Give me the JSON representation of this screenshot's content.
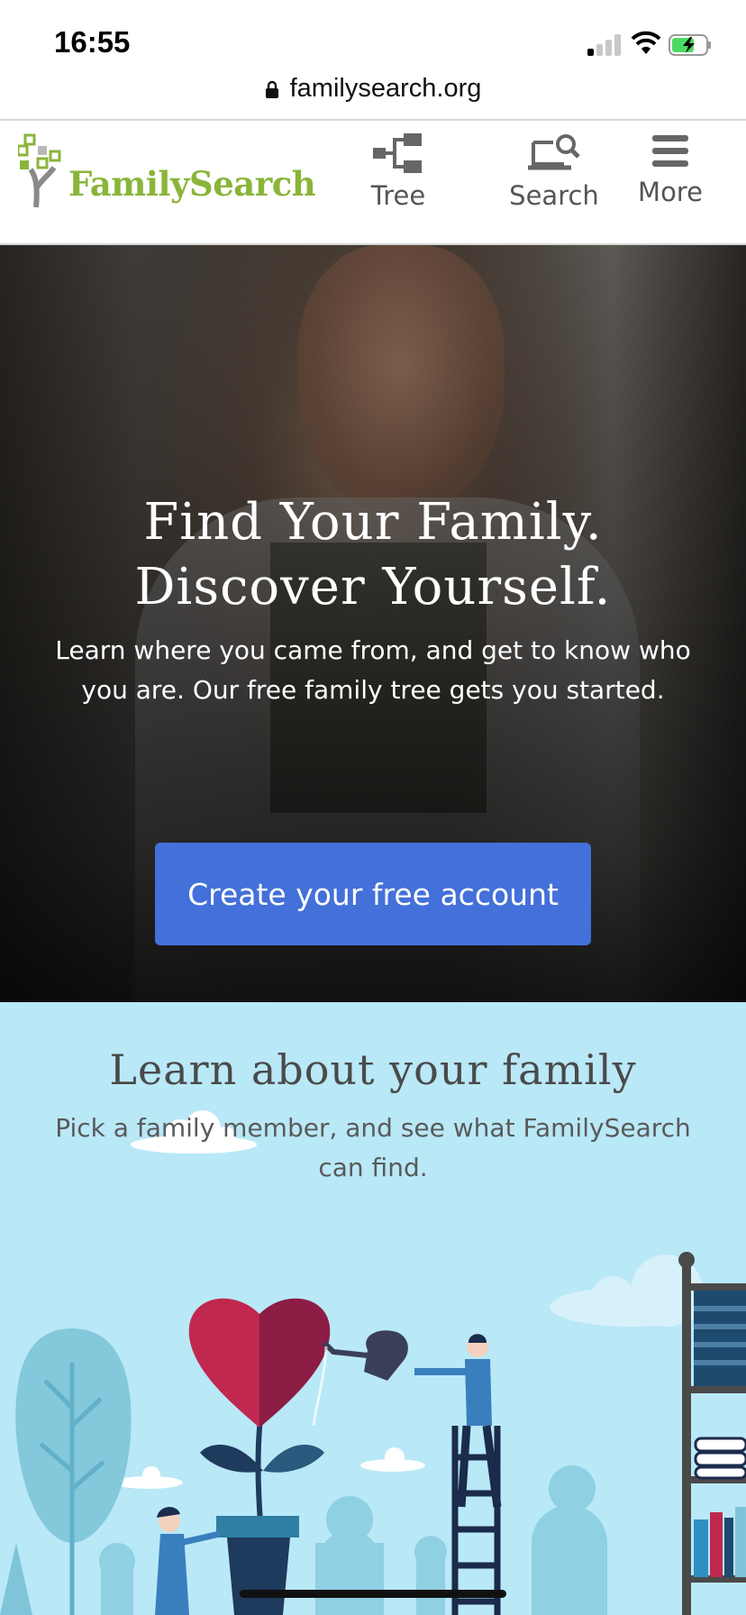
{
  "status_bar": {
    "time": "16:55",
    "url": "familysearch.org"
  },
  "header": {
    "logo_text": "FamilySearch",
    "nav": [
      {
        "label": "Tree",
        "icon": "tree-icon"
      },
      {
        "label": "Search",
        "icon": "search-icon"
      },
      {
        "label": "More",
        "icon": "menu-icon"
      }
    ]
  },
  "hero": {
    "title_line1": "Find Your Family.",
    "title_line2": "Discover Yourself.",
    "subtitle": "Learn where you came from, and get to know who you are. Our free family tree gets you started.",
    "cta_label": "Create your free account"
  },
  "learn": {
    "title": "Learn about your family",
    "subtitle": "Pick a family member, and see what FamilySearch can find."
  },
  "colors": {
    "brand_green": "#8ab53a",
    "cta_blue": "#4370d9",
    "section_bg": "#b9e8f7"
  }
}
